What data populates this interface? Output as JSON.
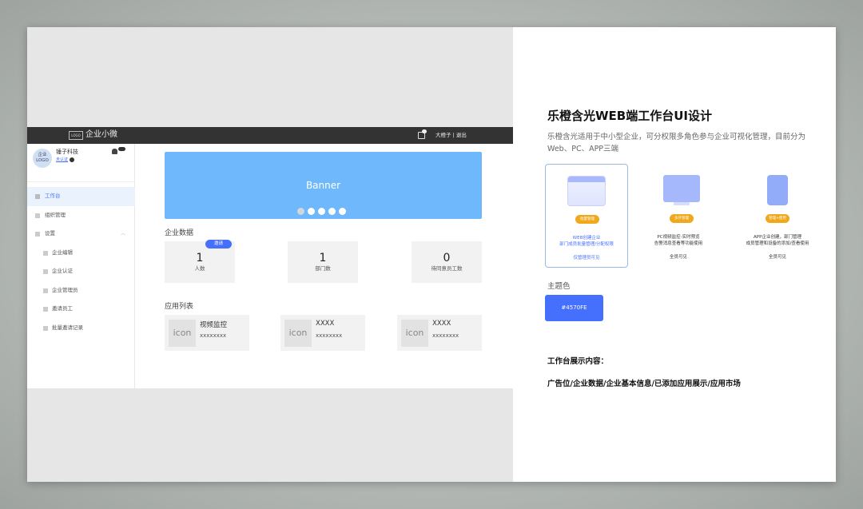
{
  "app": {
    "topbar": {
      "logo": "LOGO",
      "brand": "企业小微",
      "user": "大橙子 | 退出"
    },
    "org": {
      "avatar_line1": "企业",
      "avatar_line2": "LOGO",
      "name": "锤子科技",
      "auth": "未认证"
    },
    "menu": [
      {
        "label": "工作台",
        "active": true
      },
      {
        "label": "组织管理"
      },
      {
        "label": "设置",
        "expanded": true
      },
      {
        "label": "企业编辑"
      },
      {
        "label": "企业认证"
      },
      {
        "label": "企业管理员"
      },
      {
        "label": "邀请员工"
      },
      {
        "label": "批量邀请记录"
      }
    ],
    "banner": {
      "label": "Banner"
    },
    "stats_title": "企业数据",
    "stats": [
      {
        "num": "1",
        "label": "人数",
        "tag": "邀请"
      },
      {
        "num": "1",
        "label": "部门数"
      },
      {
        "num": "0",
        "label": "待同意员工数"
      }
    ],
    "apps_title": "应用列表",
    "apps": [
      {
        "icon": "icon",
        "name": "视频监控",
        "desc": "xxxxxxxx"
      },
      {
        "icon": "icon",
        "name": "XXXX",
        "desc": "xxxxxxxx"
      },
      {
        "icon": "icon",
        "name": "XXXX",
        "desc": "xxxxxxxx"
      }
    ]
  },
  "panel": {
    "title": "乐橙含光WEB端工作台UI设计",
    "desc": "乐橙含光适用于中小型企业，可分权限多角色参与企业可视化管理，目前分为Web、PC、APP三端",
    "features": [
      {
        "pill": "批量管理",
        "text1": "WEB创建企业",
        "text2": "部门成员批量管理/分配权限",
        "visible": "仅管理员可见"
      },
      {
        "pill": "多开管理",
        "text1": "PC视频监控-实时预览",
        "text2": "告警消息查看等功能使用",
        "visible": "全员可见"
      },
      {
        "pill": "管理+使用",
        "text1": "APP企业创建，部门管理",
        "text2": "成员管理和设备的添加/查看使用",
        "visible": "全员可见"
      }
    ],
    "theme_label": "主题色",
    "theme_color": "#4570FE",
    "show_label": "工作台展示内容：",
    "show_value": "广告位/企业数据/企业基本信息/已添加应用展示/应用市场"
  }
}
